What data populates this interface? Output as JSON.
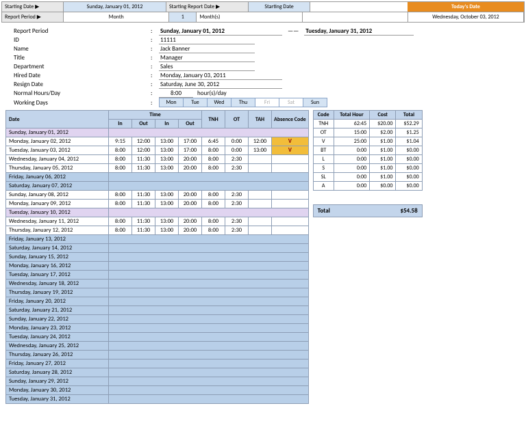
{
  "topbar": {
    "startingDateLbl": "Starting Date ▶",
    "startingDateVal": "Sunday, January 01, 2012",
    "startRptLbl": "Starting Report Date ▶",
    "startRptVal": "Starting Date",
    "todayLbl": "Today's Date",
    "todayVal": "Wednesday, October 03, 2012",
    "periodLbl": "Report Period ▶",
    "monthLbl": "Month",
    "monthVal": "1",
    "monthsLbl": "Month(s)"
  },
  "info": {
    "rptPeriodLbl": "Report Period",
    "rptFrom": "Sunday, January 01, 2012",
    "rptTo": "Tuesday, January 31, 2012",
    "idLbl": "ID",
    "idVal": "11111",
    "nameLbl": "Name",
    "nameVal": "Jack Banner",
    "titleLbl": "Title",
    "titleVal": "Manager",
    "deptLbl": "Department",
    "deptVal": "Sales",
    "hiredLbl": "Hired Date",
    "hiredVal": "Monday, January 03, 2011",
    "resignLbl": "Resign Date",
    "resignVal": "Saturday, June 30, 2012",
    "hoursLbl": "Normal Hours/Day",
    "hoursVal": "8:00",
    "hoursUnit": "hour(s)/day",
    "workLbl": "Working Days",
    "days": [
      "Mon",
      "Tue",
      "Wed",
      "Thu",
      "Fri",
      "Sat",
      "Sun"
    ],
    "daysOff": [
      4,
      5
    ]
  },
  "hdr": {
    "date": "Date",
    "time": "Time",
    "in": "In",
    "out": "Out",
    "tnh": "TNH",
    "ot": "OT",
    "tah": "TAH",
    "abs": "Absence Code"
  },
  "rows": [
    {
      "d": "Sunday, January 01, 2012",
      "t": "holiday"
    },
    {
      "d": "Monday, January 02, 2012",
      "t": "work",
      "in1": "9:15",
      "out1": "12:00",
      "in2": "13:00",
      "out2": "17:00",
      "tnh": "6:45",
      "ot": "0:00",
      "tah": "12:00",
      "abs": "V"
    },
    {
      "d": "Tuesday, January 03, 2012",
      "t": "work",
      "in1": "8:00",
      "out1": "12:00",
      "in2": "13:00",
      "out2": "17:00",
      "tnh": "8:00",
      "ot": "0:00",
      "tah": "13:00",
      "abs": "V"
    },
    {
      "d": "Wednesday, January 04, 2012",
      "t": "work",
      "in1": "8:00",
      "out1": "11:30",
      "in2": "13:00",
      "out2": "20:00",
      "tnh": "8:00",
      "ot": "2:30",
      "tah": "",
      "abs": ""
    },
    {
      "d": "Thursday, January 05, 2012",
      "t": "work",
      "in1": "8:00",
      "out1": "11:30",
      "in2": "13:00",
      "out2": "20:00",
      "tnh": "8:00",
      "ot": "2:30",
      "tah": "",
      "abs": ""
    },
    {
      "d": "Friday, January 06, 2012",
      "t": "weekend"
    },
    {
      "d": "Saturday, January 07, 2012",
      "t": "weekend"
    },
    {
      "d": "Sunday, January 08, 2012",
      "t": "work",
      "in1": "8:00",
      "out1": "11:30",
      "in2": "13:00",
      "out2": "20:00",
      "tnh": "8:00",
      "ot": "2:30",
      "tah": "",
      "abs": ""
    },
    {
      "d": "Monday, January 09, 2012",
      "t": "work",
      "in1": "8:00",
      "out1": "11:30",
      "in2": "13:00",
      "out2": "20:00",
      "tnh": "8:00",
      "ot": "2:30",
      "tah": "",
      "abs": ""
    },
    {
      "d": "Tuesday, January 10, 2012",
      "t": "holiday"
    },
    {
      "d": "Wednesday, January 11, 2012",
      "t": "work",
      "in1": "8:00",
      "out1": "11:30",
      "in2": "13:00",
      "out2": "20:00",
      "tnh": "8:00",
      "ot": "2:30",
      "tah": "",
      "abs": ""
    },
    {
      "d": "Thursday, January 12, 2012",
      "t": "work",
      "in1": "8:00",
      "out1": "11:30",
      "in2": "13:00",
      "out2": "20:00",
      "tnh": "8:00",
      "ot": "2:30",
      "tah": "",
      "abs": ""
    },
    {
      "d": "Friday, January 13, 2012",
      "t": "weekend"
    },
    {
      "d": "Saturday, January 14, 2012",
      "t": "weekend"
    },
    {
      "d": "Sunday, January 15, 2012",
      "t": "weekend"
    },
    {
      "d": "Monday, January 16, 2012",
      "t": "weekend"
    },
    {
      "d": "Tuesday, January 17, 2012",
      "t": "weekend"
    },
    {
      "d": "Wednesday, January 18, 2012",
      "t": "weekend"
    },
    {
      "d": "Thursday, January 19, 2012",
      "t": "weekend"
    },
    {
      "d": "Friday, January 20, 2012",
      "t": "weekend"
    },
    {
      "d": "Saturday, January 21, 2012",
      "t": "weekend"
    },
    {
      "d": "Sunday, January 22, 2012",
      "t": "weekend"
    },
    {
      "d": "Monday, January 23, 2012",
      "t": "weekend"
    },
    {
      "d": "Tuesday, January 24, 2012",
      "t": "weekend"
    },
    {
      "d": "Wednesday, January 25, 2012",
      "t": "weekend"
    },
    {
      "d": "Thursday, January 26, 2012",
      "t": "weekend"
    },
    {
      "d": "Friday, January 27, 2012",
      "t": "weekend"
    },
    {
      "d": "Saturday, January 28, 2012",
      "t": "weekend"
    },
    {
      "d": "Sunday, January 29, 2012",
      "t": "weekend"
    },
    {
      "d": "Monday, January 30, 2012",
      "t": "weekend"
    },
    {
      "d": "Tuesday, January 31, 2012",
      "t": "weekend"
    }
  ],
  "sidehdr": {
    "code": "Code",
    "th": "Total Hour",
    "cost": "Cost",
    "total": "Total"
  },
  "side": [
    {
      "c": "TNH",
      "h": "62:45",
      "cost": "$20.00",
      "t": "$52.29"
    },
    {
      "c": "OT",
      "h": "15:00",
      "cost": "$2.00",
      "t": "$1.25"
    },
    {
      "c": "V",
      "h": "25:00",
      "cost": "$1.00",
      "t": "$1.04"
    },
    {
      "c": "BT",
      "h": "0:00",
      "cost": "$1.00",
      "t": "$0.00"
    },
    {
      "c": "L",
      "h": "0:00",
      "cost": "$1.00",
      "t": "$0.00"
    },
    {
      "c": "S",
      "h": "0:00",
      "cost": "$1.00",
      "t": "$0.00"
    },
    {
      "c": "SL",
      "h": "0:00",
      "cost": "$1.00",
      "t": "$0.00"
    },
    {
      "c": "A",
      "h": "0:00",
      "cost": "$0.00",
      "t": "$0.00"
    }
  ],
  "grandTotal": {
    "lbl": "Total",
    "val": "$54.58"
  }
}
